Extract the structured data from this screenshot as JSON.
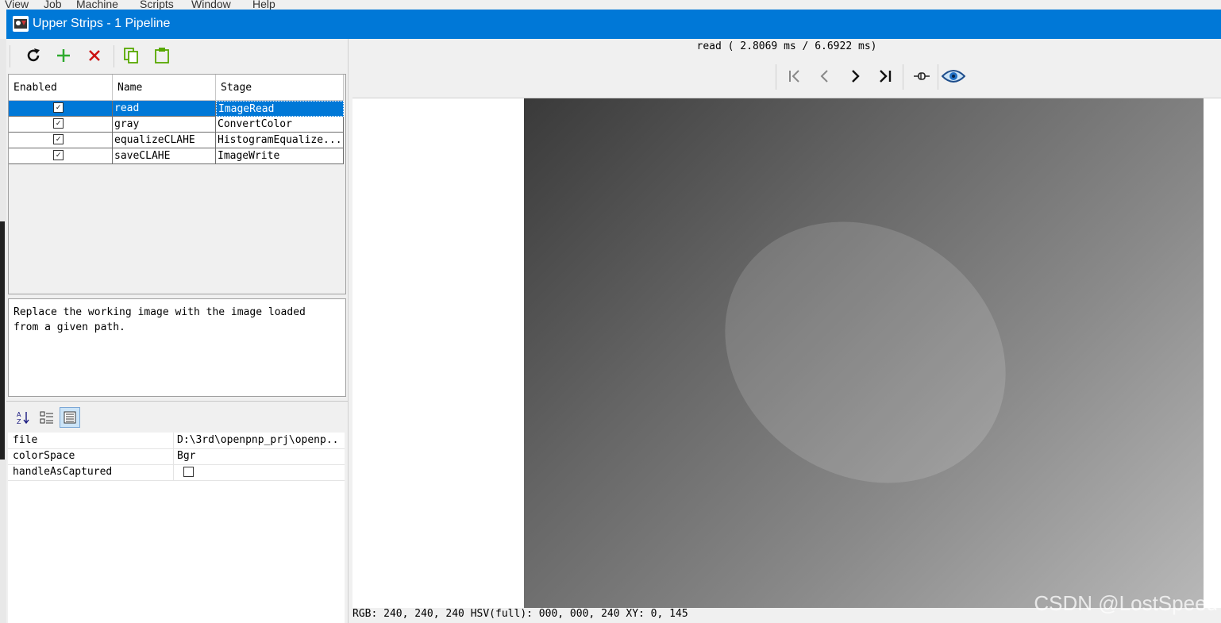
{
  "background_menu": [
    "View",
    "Job",
    "Machine",
    "Scripts",
    "Window",
    "Help"
  ],
  "window": {
    "title": "Upper Strips - 1 Pipeline"
  },
  "toolbar": {
    "buttons": [
      "refresh-icon",
      "add-icon",
      "delete-icon",
      "copy-icon",
      "paste-icon"
    ]
  },
  "pipeline": {
    "columns": [
      "Enabled",
      "Name",
      "Stage"
    ],
    "rows": [
      {
        "enabled": true,
        "name": "read",
        "stage": "ImageRead",
        "selected": true
      },
      {
        "enabled": true,
        "name": "gray",
        "stage": "ConvertColor",
        "selected": false
      },
      {
        "enabled": true,
        "name": "equalizeCLAHE",
        "stage": "HistogramEqualize...",
        "selected": false
      },
      {
        "enabled": true,
        "name": "saveCLAHE",
        "stage": "ImageWrite",
        "selected": false
      }
    ]
  },
  "description": "Replace the working image with the image loaded\nfrom a given path.",
  "properties": {
    "rows": [
      {
        "key": "file",
        "value": "D:\\3rd\\openpnp_prj\\openp..",
        "type": "text"
      },
      {
        "key": "colorSpace",
        "value": "Bgr",
        "type": "text"
      },
      {
        "key": "handleAsCaptured",
        "value": "",
        "type": "checkbox",
        "checked": false
      }
    ]
  },
  "preview": {
    "timing": "read ( 2.8069 ms / 6.6922 ms)",
    "nav_buttons": [
      "first-icon",
      "prev-icon",
      "next-icon",
      "last-icon",
      "pin-icon",
      "eye-icon"
    ],
    "status": "RGB: 240, 240, 240 HSV(full): 000, 000, 240 XY: 0, 145"
  },
  "watermark": "CSDN @LostSpeed",
  "colors": {
    "titlebar": "#0078d7",
    "selection": "#0078d7",
    "add": "#2eaa2e",
    "delete": "#cc1111",
    "copy_paste": "#57a800"
  }
}
